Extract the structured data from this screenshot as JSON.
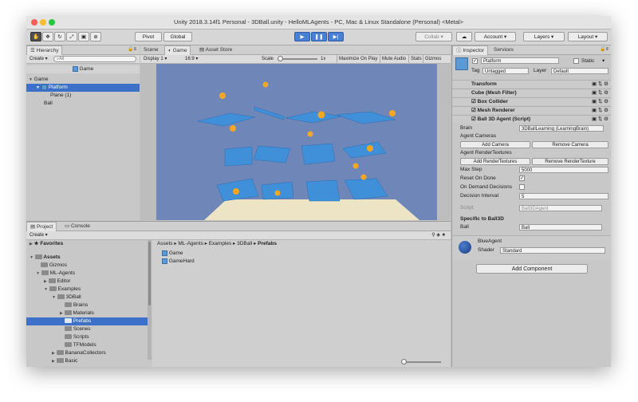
{
  "window": {
    "title": "Unity 2018.3.14f1 Personal - 3DBall.unity - HelloMLAgents - PC, Mac & Linux Standalone (Personal) <Metal>"
  },
  "toolbar": {
    "pivot": "Pivot",
    "global": "Global",
    "collab": "Collab",
    "account": "Account",
    "layers": "Layers",
    "layout": "Layout"
  },
  "hierarchy": {
    "tab": "Hierarchy",
    "create": "Create",
    "search_placeholder": "All",
    "scene_root": "Game",
    "items": [
      "Game",
      "Platform",
      "Plane (1)",
      "Ball"
    ]
  },
  "scene_view": {
    "tabs": [
      "Scene",
      "Game",
      "Asset Store"
    ],
    "display": "Display 1",
    "aspect": "16:9",
    "scale_label": "Scale",
    "scale_value": "1x",
    "options": [
      "Maximize On Play",
      "Mute Audio",
      "Stats",
      "Gizmos"
    ]
  },
  "project": {
    "tabs": [
      "Project",
      "Console"
    ],
    "create": "Create",
    "favorites": "Favorites",
    "tree": [
      "Assets",
      "Gizmos",
      "ML-Agents",
      "Editor",
      "Examples",
      "3DBall",
      "Brains",
      "Materials",
      "Prefabs",
      "Scenes",
      "Scripts",
      "TFModels",
      "BananaCollectors",
      "Basic"
    ],
    "breadcrumb": [
      "Assets",
      "ML-Agents",
      "Examples",
      "3DBall",
      "Prefabs"
    ],
    "files": [
      "Game",
      "GameHard"
    ]
  },
  "inspector": {
    "tabs": [
      "Inspector",
      "Services"
    ],
    "object_name": "Platform",
    "static_label": "Static",
    "tag_label": "Tag",
    "tag_value": "Untagged",
    "layer_label": "Layer",
    "layer_value": "Default",
    "components": [
      "Transform",
      "Cube (Mesh Filter)",
      "Box Collider",
      "Mesh Renderer",
      "Ball 3D Agent (Script)"
    ],
    "brain_label": "Brain",
    "brain_value": "3DBallLearning (LearningBrain)",
    "agent_cameras": "Agent Cameras",
    "add_camera": "Add Camera",
    "remove_camera": "Remove Camera",
    "agent_rendertextures": "Agent RenderTextures",
    "add_rendertextures": "Add RenderTextures",
    "remove_rendertexture": "Remove RenderTexture",
    "max_step_label": "Max Step",
    "max_step_value": "5000",
    "reset_on_done_label": "Reset On Done",
    "on_demand_label": "On Demand Decisions",
    "decision_interval_label": "Decision Interval",
    "decision_interval_value": "5",
    "script_label": "Script",
    "script_value": "Ball3DAgent",
    "specific_label": "Specific to Ball3D",
    "ball_label": "Ball",
    "ball_value": "Ball",
    "material_name": "BlueAgent",
    "shader_label": "Shader",
    "shader_value": "Standard",
    "add_component": "Add Component"
  },
  "colors": {
    "accent": "#3d71c9",
    "game_background": "#6f86b8",
    "ground": "#ece4c4",
    "platform": "#3f8fd9",
    "ball": "#f5a623"
  }
}
